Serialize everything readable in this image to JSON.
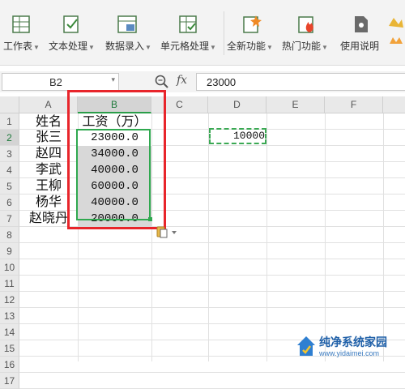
{
  "ribbon": {
    "items": [
      {
        "label": "工作表",
        "icon": "worksheet-icon"
      },
      {
        "label": "文本处理",
        "icon": "text-processing-icon"
      },
      {
        "label": "数据录入",
        "icon": "data-entry-icon"
      },
      {
        "label": "单元格处理",
        "icon": "cell-processing-icon"
      },
      {
        "label": "全新功能",
        "icon": "new-features-icon"
      },
      {
        "label": "热门功能",
        "icon": "hot-features-icon"
      },
      {
        "label": "使用说明",
        "icon": "help-doc-icon"
      }
    ]
  },
  "formula_bar": {
    "name_box": "B2",
    "fx_label": "fx",
    "value": "23000"
  },
  "grid": {
    "columns": [
      "A",
      "B",
      "C",
      "D",
      "E",
      "F"
    ],
    "rows": [
      "1",
      "2",
      "3",
      "4",
      "5",
      "6",
      "7",
      "8",
      "9",
      "10",
      "11",
      "12",
      "13",
      "14",
      "15",
      "16",
      "17"
    ],
    "headers": {
      "name": "姓名",
      "salary": "工资（万）"
    },
    "data": [
      {
        "name": "张三",
        "salary": "23000.0"
      },
      {
        "name": "赵四",
        "salary": "34000.0"
      },
      {
        "name": "李武",
        "salary": "40000.0"
      },
      {
        "name": "王柳",
        "salary": "60000.0"
      },
      {
        "name": "杨华",
        "salary": "40000.0"
      },
      {
        "name": "赵晓丹",
        "salary": "20000.0"
      }
    ],
    "copied_cell_value": "10000",
    "active_column": "B"
  },
  "watermark": {
    "text": "纯净系统家园",
    "url": "www.yidaimei.com"
  },
  "colors": {
    "selection": "#2fa84f",
    "highlight_box": "#e8252b",
    "selected_fill": "#d8d8d8"
  }
}
